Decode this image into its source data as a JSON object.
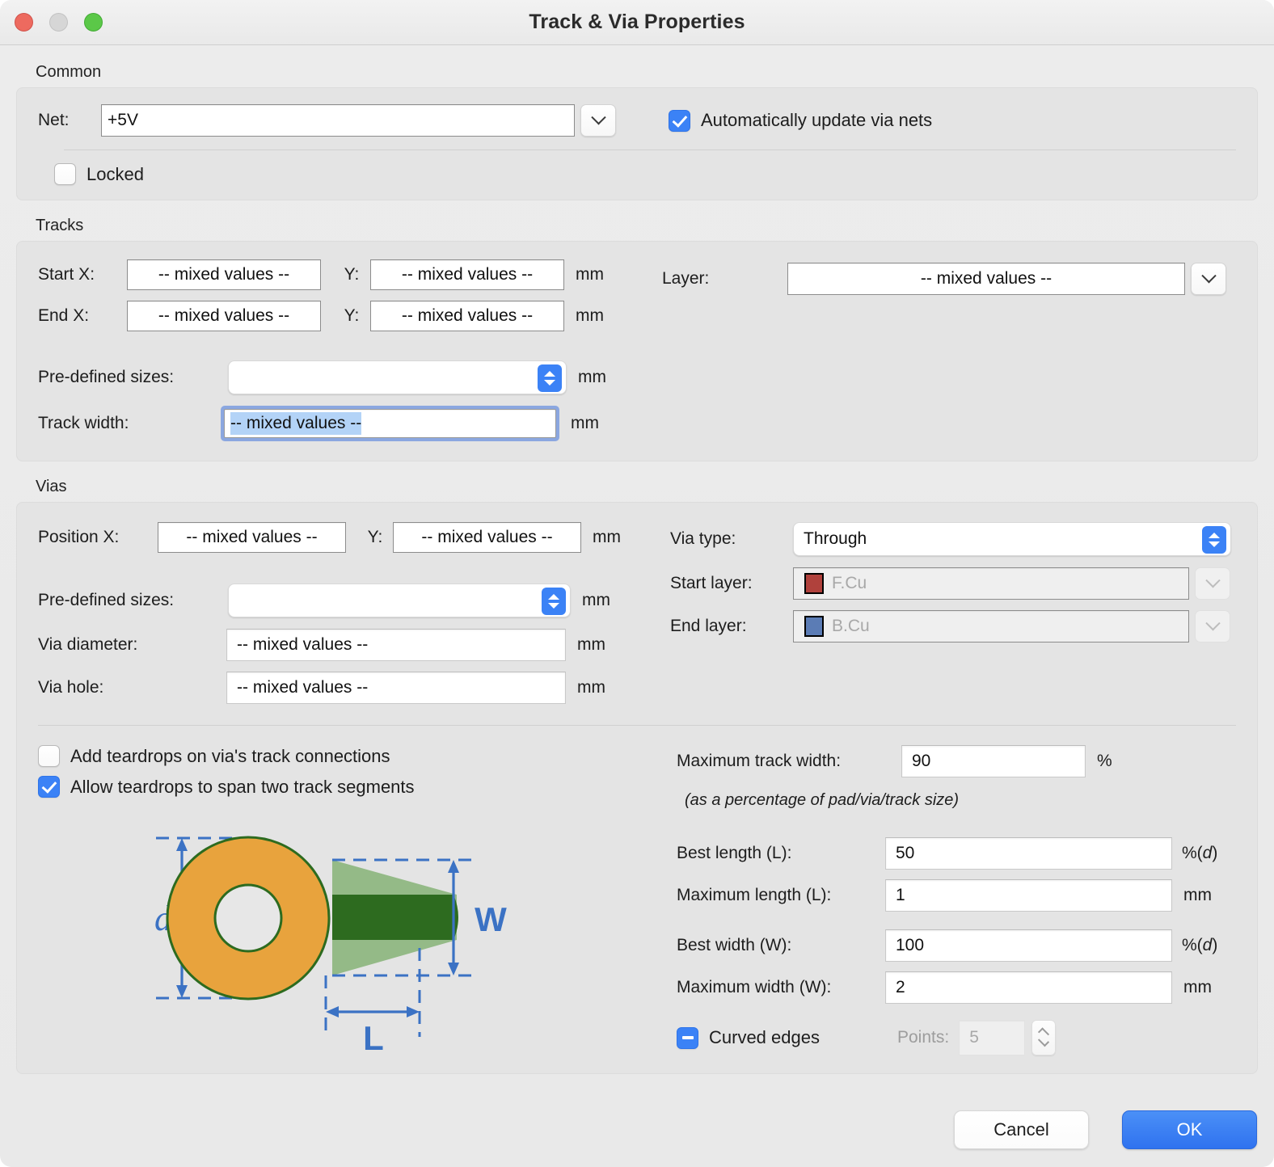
{
  "window": {
    "title": "Track & Via Properties",
    "traffic_lights": [
      "close-button",
      "minimize-button",
      "zoom-button"
    ]
  },
  "common": {
    "group_label": "Common",
    "net_label": "Net:",
    "net_value": "+5V",
    "auto_update_label": "Automatically update via nets",
    "auto_update_checked": true,
    "locked_label": "Locked",
    "locked_checked": false
  },
  "tracks": {
    "group_label": "Tracks",
    "start_x_label": "Start X:",
    "start_x_value": "-- mixed values --",
    "start_y_label": "Y:",
    "start_y_value": "-- mixed values --",
    "start_unit": "mm",
    "end_x_label": "End X:",
    "end_x_value": "-- mixed values --",
    "end_y_label": "Y:",
    "end_y_value": "-- mixed values --",
    "end_unit": "mm",
    "predefined_label": "Pre-defined sizes:",
    "predefined_value": "",
    "predefined_unit": "mm",
    "track_width_label": "Track width:",
    "track_width_value": "-- mixed values --",
    "track_width_unit": "mm",
    "layer_label": "Layer:",
    "layer_value": "-- mixed values --"
  },
  "vias": {
    "group_label": "Vias",
    "position_x_label": "Position X:",
    "position_x_value": "-- mixed values --",
    "position_y_label": "Y:",
    "position_y_value": "-- mixed values --",
    "position_unit": "mm",
    "predefined_label": "Pre-defined sizes:",
    "predefined_value": "",
    "predefined_unit": "mm",
    "diameter_label": "Via diameter:",
    "diameter_value": "-- mixed values --",
    "diameter_unit": "mm",
    "hole_label": "Via hole:",
    "hole_value": "-- mixed values --",
    "hole_unit": "mm",
    "via_type_label": "Via type:",
    "via_type_value": "Through",
    "start_layer_label": "Start layer:",
    "start_layer_value": "F.Cu",
    "start_layer_color": "#b0413c",
    "end_layer_label": "End layer:",
    "end_layer_value": "B.Cu",
    "end_layer_color": "#5b7cb5"
  },
  "teardrops": {
    "add_label": "Add teardrops on via's track connections",
    "add_checked": false,
    "span_label": "Allow teardrops to span two track segments",
    "span_checked": true,
    "max_track_width_label": "Maximum track width:",
    "max_track_width_value": "90",
    "max_track_width_unit": "%",
    "percentage_note": "(as a percentage of pad/via/track size)",
    "best_length_label": "Best length (L):",
    "best_length_value": "50",
    "best_length_unit": "%(d)",
    "max_length_label": "Maximum length (L):",
    "max_length_value": "1",
    "max_length_unit": "mm",
    "best_width_label": "Best width (W):",
    "best_width_value": "100",
    "best_width_unit": "%(d)",
    "max_width_label": "Maximum width (W):",
    "max_width_value": "2",
    "max_width_unit": "mm",
    "curved_edges_label": "Curved edges",
    "curved_edges_state": "mixed",
    "points_label": "Points:",
    "points_value": "5",
    "points_enabled": false,
    "diagram": {
      "d_label": "d",
      "w_label": "W",
      "l_label": "L",
      "pad_color": "#e8a33d",
      "pad_border_color": "#2d6b1f",
      "teardrop_color": "#2d6b1f",
      "teardrop_light_color": "#86b377",
      "dimension_color": "#3b72c4"
    }
  },
  "footer": {
    "cancel_label": "Cancel",
    "ok_label": "OK"
  }
}
